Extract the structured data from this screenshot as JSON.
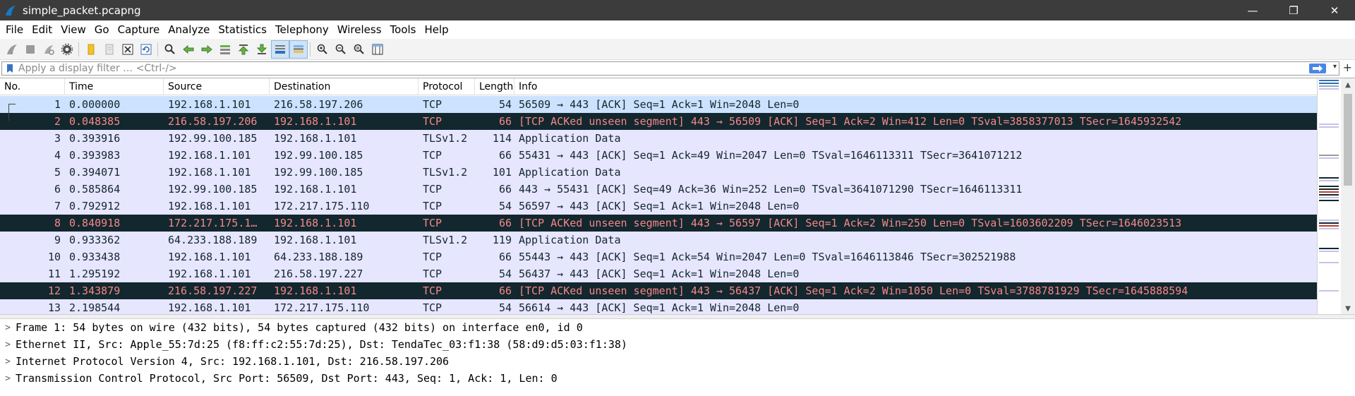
{
  "window": {
    "title": "simple_packet.pcapng",
    "minimize": "—",
    "restore": "❐",
    "close": "✕"
  },
  "menu": [
    "File",
    "Edit",
    "View",
    "Go",
    "Capture",
    "Analyze",
    "Statistics",
    "Telephony",
    "Wireless",
    "Tools",
    "Help"
  ],
  "filter": {
    "placeholder": "Apply a display filter … <Ctrl-/>",
    "value": "",
    "plus": "+"
  },
  "columns": [
    "No.",
    "Time",
    "Source",
    "Destination",
    "Protocol",
    "Length",
    "Info"
  ],
  "packets": [
    {
      "no": "1",
      "time": "0.000000",
      "src": "192.168.1.101",
      "dst": "216.58.197.206",
      "proto": "TCP",
      "len": "54",
      "info": "56509 → 443 [ACK] Seq=1 Ack=1 Win=2048 Len=0",
      "style": "selected"
    },
    {
      "no": "2",
      "time": "0.048385",
      "src": "216.58.197.206",
      "dst": "192.168.1.101",
      "proto": "TCP",
      "len": "66",
      "info": "[TCP ACKed unseen segment] 443 → 56509 [ACK] Seq=1 Ack=2 Win=412 Len=0 TSval=3858377013 TSecr=1645932542",
      "style": "bad"
    },
    {
      "no": "3",
      "time": "0.393916",
      "src": "192.99.100.185",
      "dst": "192.168.1.101",
      "proto": "TLSv1.2",
      "len": "114",
      "info": "Application Data",
      "style": "normal"
    },
    {
      "no": "4",
      "time": "0.393983",
      "src": "192.168.1.101",
      "dst": "192.99.100.185",
      "proto": "TCP",
      "len": "66",
      "info": "55431 → 443 [ACK] Seq=1 Ack=49 Win=2047 Len=0 TSval=1646113311 TSecr=3641071212",
      "style": "normal"
    },
    {
      "no": "5",
      "time": "0.394071",
      "src": "192.168.1.101",
      "dst": "192.99.100.185",
      "proto": "TLSv1.2",
      "len": "101",
      "info": "Application Data",
      "style": "normal"
    },
    {
      "no": "6",
      "time": "0.585864",
      "src": "192.99.100.185",
      "dst": "192.168.1.101",
      "proto": "TCP",
      "len": "66",
      "info": "443 → 55431 [ACK] Seq=49 Ack=36 Win=252 Len=0 TSval=3641071290 TSecr=1646113311",
      "style": "normal"
    },
    {
      "no": "7",
      "time": "0.792912",
      "src": "192.168.1.101",
      "dst": "172.217.175.110",
      "proto": "TCP",
      "len": "54",
      "info": "56597 → 443 [ACK] Seq=1 Ack=1 Win=2048 Len=0",
      "style": "normal"
    },
    {
      "no": "8",
      "time": "0.840918",
      "src": "172.217.175.1…",
      "dst": "192.168.1.101",
      "proto": "TCP",
      "len": "66",
      "info": "[TCP ACKed unseen segment] 443 → 56597 [ACK] Seq=1 Ack=2 Win=250 Len=0 TSval=1603602209 TSecr=1646023513",
      "style": "bad"
    },
    {
      "no": "9",
      "time": "0.933362",
      "src": "64.233.188.189",
      "dst": "192.168.1.101",
      "proto": "TLSv1.2",
      "len": "119",
      "info": "Application Data",
      "style": "normal"
    },
    {
      "no": "10",
      "time": "0.933438",
      "src": "192.168.1.101",
      "dst": "64.233.188.189",
      "proto": "TCP",
      "len": "66",
      "info": "55443 → 443 [ACK] Seq=1 Ack=54 Win=2047 Len=0 TSval=1646113846 TSecr=302521988",
      "style": "normal"
    },
    {
      "no": "11",
      "time": "1.295192",
      "src": "192.168.1.101",
      "dst": "216.58.197.227",
      "proto": "TCP",
      "len": "54",
      "info": "56437 → 443 [ACK] Seq=1 Ack=1 Win=2048 Len=0",
      "style": "normal"
    },
    {
      "no": "12",
      "time": "1.343879",
      "src": "216.58.197.227",
      "dst": "192.168.1.101",
      "proto": "TCP",
      "len": "66",
      "info": "[TCP ACKed unseen segment] 443 → 56437 [ACK] Seq=1 Ack=2 Win=1050 Len=0 TSval=3788781929 TSecr=1645888594",
      "style": "bad"
    },
    {
      "no": "13",
      "time": "2.198544",
      "src": "192.168.1.101",
      "dst": "172.217.175.110",
      "proto": "TCP",
      "len": "54",
      "info": "56614 → 443 [ACK] Seq=1 Ack=1 Win=2048 Len=0",
      "style": "normal"
    }
  ],
  "details": [
    "Frame 1: 54 bytes on wire (432 bits), 54 bytes captured (432 bits) on interface en0, id 0",
    "Ethernet II, Src: Apple_55:7d:25 (f8:ff:c2:55:7d:25), Dst: TendaTec_03:f1:38 (58:d9:d5:03:f1:38)",
    "Internet Protocol Version 4, Src: 192.168.1.101, Dst: 216.58.197.206",
    "Transmission Control Protocol, Src Port: 56509, Dst Port: 443, Seq: 1, Ack: 1, Len: 0"
  ],
  "toolbar_icons": [
    "shark-fin-start-icon",
    "stop-icon",
    "restart-icon",
    "options-gear-icon",
    "open-file-icon",
    "save-file-icon",
    "close-file-icon",
    "reload-icon",
    "find-icon",
    "back-arrow-icon",
    "forward-arrow-icon",
    "goto-packet-icon",
    "first-packet-icon",
    "last-packet-icon",
    "autoscroll-icon",
    "colorize-icon",
    "zoom-in-icon",
    "zoom-out-icon",
    "zoom-normal-icon",
    "resize-columns-icon"
  ],
  "colors": {
    "titlebar": "#3c3c3c",
    "row_normal_bg": "#e7e6ff",
    "row_selected_bg": "#cce2ff",
    "row_bad_bg": "#12272e",
    "row_bad_fg": "#f78787"
  }
}
